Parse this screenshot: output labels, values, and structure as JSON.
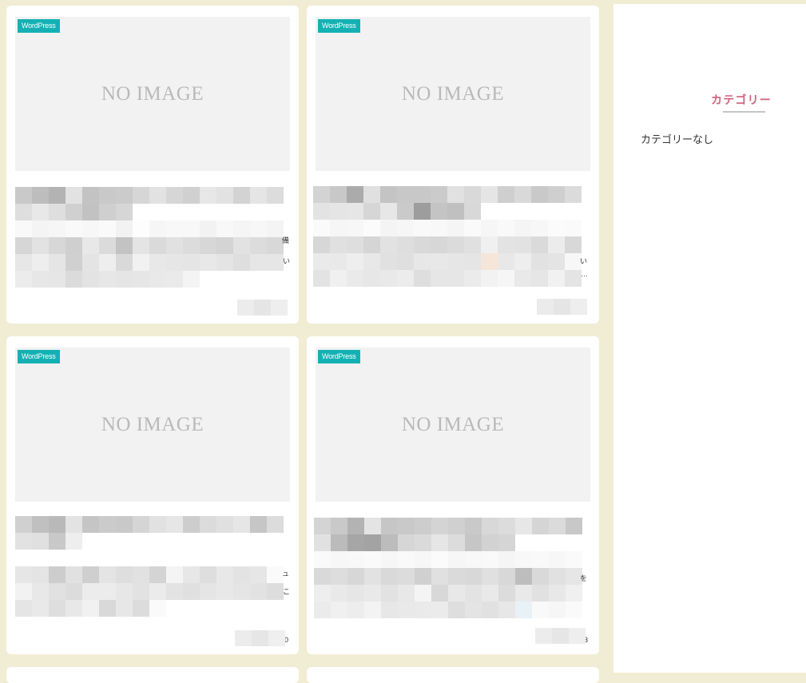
{
  "posts": [
    {
      "category": "WordPress",
      "thumbnail_text": "NO IMAGE",
      "edge_glyphs": [
        "備",
        "い",
        ""
      ]
    },
    {
      "category": "WordPress",
      "thumbnail_text": "NO IMAGE",
      "edge_glyphs": [
        "",
        "い",
        "…"
      ]
    },
    {
      "category": "WordPress",
      "thumbnail_text": "NO IMAGE",
      "edge_glyphs": [
        "ュ",
        "こ",
        "0"
      ]
    },
    {
      "category": "WordPress",
      "thumbnail_text": "NO IMAGE",
      "edge_glyphs": [
        "",
        "を",
        "3"
      ]
    }
  ],
  "sidebar": {
    "title": "カテゴリー",
    "items": [
      {
        "label": "カテゴリーなし"
      }
    ]
  },
  "colors": {
    "page_background": "#f1edd4",
    "badge": "#14b1b4",
    "sidebar_title": "#d1607f"
  }
}
